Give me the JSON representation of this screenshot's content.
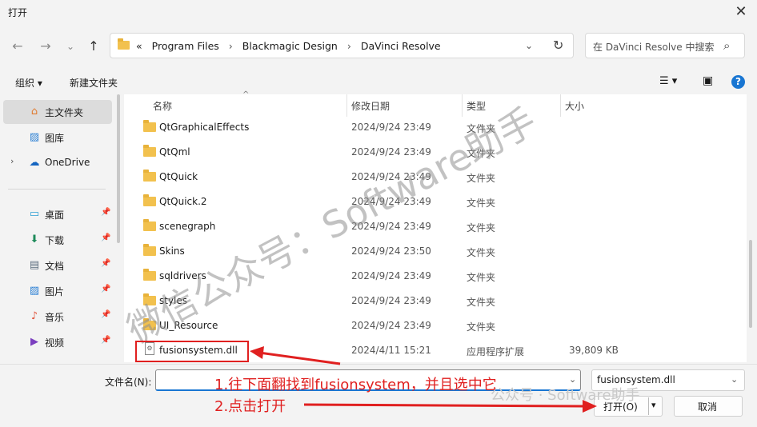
{
  "window": {
    "title": "打开",
    "close_glyph": "✕"
  },
  "nav": {
    "back": "←",
    "forward": "→",
    "recent": "⌄",
    "up": "↑"
  },
  "address": {
    "prefix": "«",
    "crumbs": [
      "Program Files",
      "Blackmagic Design",
      "DaVinci Resolve"
    ],
    "separator": "›",
    "dropdown": "⌄",
    "refresh": "↻"
  },
  "search": {
    "placeholder": "在 DaVinci Resolve 中搜索",
    "icon": "⌕"
  },
  "toolbar": {
    "organize": "组织 ▾",
    "new_folder": "新建文件夹",
    "view_icon": "☰ ▾",
    "pane_icon": "▣",
    "help": "?"
  },
  "sidebar": {
    "items": [
      {
        "label": "主文件夹",
        "icon": "⌂",
        "color": "#e07a2e"
      },
      {
        "label": "图库",
        "icon": "▨",
        "color": "#2a7fd4"
      },
      {
        "label": "OneDrive",
        "icon": "☁",
        "color": "#1565c0",
        "arrow": "›"
      },
      {
        "label": "桌面",
        "icon": "▭",
        "color": "#2a9fd4",
        "pin": "📌"
      },
      {
        "label": "下载",
        "icon": "⬇",
        "color": "#1e8a5a",
        "pin": "📌"
      },
      {
        "label": "文档",
        "icon": "▤",
        "color": "#5a6b7c",
        "pin": "📌"
      },
      {
        "label": "图片",
        "icon": "▨",
        "color": "#2a7fd4",
        "pin": "📌"
      },
      {
        "label": "音乐",
        "icon": "♪",
        "color": "#e0533a",
        "pin": "📌"
      },
      {
        "label": "视频",
        "icon": "▶",
        "color": "#7b3fbf",
        "pin": "📌"
      }
    ]
  },
  "columns": {
    "name": "名称",
    "date": "修改日期",
    "type": "类型",
    "size": "大小",
    "sort_caret": "^"
  },
  "files": [
    {
      "name": "QtGraphicalEffects",
      "date": "2024/9/24 23:49",
      "type": "文件夹",
      "size": ""
    },
    {
      "name": "QtQml",
      "date": "2024/9/24 23:49",
      "type": "文件夹",
      "size": ""
    },
    {
      "name": "QtQuick",
      "date": "2024/9/24 23:49",
      "type": "文件夹",
      "size": ""
    },
    {
      "name": "QtQuick.2",
      "date": "2024/9/24 23:49",
      "type": "文件夹",
      "size": ""
    },
    {
      "name": "scenegraph",
      "date": "2024/9/24 23:49",
      "type": "文件夹",
      "size": ""
    },
    {
      "name": "Skins",
      "date": "2024/9/24 23:50",
      "type": "文件夹",
      "size": ""
    },
    {
      "name": "sqldrivers",
      "date": "2024/9/24 23:49",
      "type": "文件夹",
      "size": ""
    },
    {
      "name": "styles",
      "date": "2024/9/24 23:49",
      "type": "文件夹",
      "size": ""
    },
    {
      "name": "UI_Resource",
      "date": "2024/9/24 23:49",
      "type": "文件夹",
      "size": ""
    },
    {
      "name": "fusionsystem.dll",
      "date": "2024/4/11 15:21",
      "type": "应用程序扩展",
      "size": "39,809 KB"
    }
  ],
  "footer": {
    "filename_label": "文件名(N):",
    "filename_value": "",
    "dropdown": "⌄",
    "filetype": "fusionsystem.dll",
    "open": "打开(O)",
    "open_dd": "▾",
    "cancel": "取消"
  },
  "annotations": {
    "step1": "1.往下面翻找到fusionsystem，并且选中它",
    "step2": "2.点击打开",
    "color": "#e02020"
  },
  "watermark": {
    "main": "微信公众号：Software助手",
    "small": "公众号 · Software助手"
  }
}
